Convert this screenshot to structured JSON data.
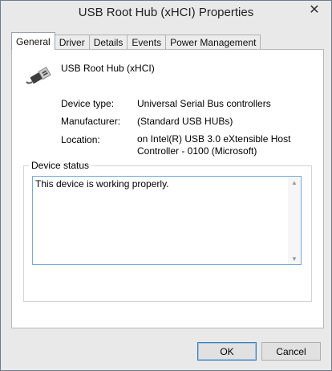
{
  "window": {
    "title": "USB Root Hub (xHCI) Properties",
    "close_glyph": "✕"
  },
  "tabs": [
    {
      "label": "General"
    },
    {
      "label": "Driver"
    },
    {
      "label": "Details"
    },
    {
      "label": "Events"
    },
    {
      "label": "Power Management"
    }
  ],
  "general": {
    "device_name": "USB Root Hub (xHCI)",
    "device_type_label": "Device type:",
    "device_type_value": "Universal Serial Bus controllers",
    "manufacturer_label": "Manufacturer:",
    "manufacturer_value": "(Standard USB HUBs)",
    "location_label": "Location:",
    "location_value": "on Intel(R) USB 3.0 eXtensible Host Controller - 0100 (Microsoft)",
    "status_group_title": "Device status",
    "status_text": "This device is working properly."
  },
  "buttons": {
    "ok": "OK",
    "cancel": "Cancel"
  },
  "icons": {
    "device": "usb-connector-icon"
  }
}
